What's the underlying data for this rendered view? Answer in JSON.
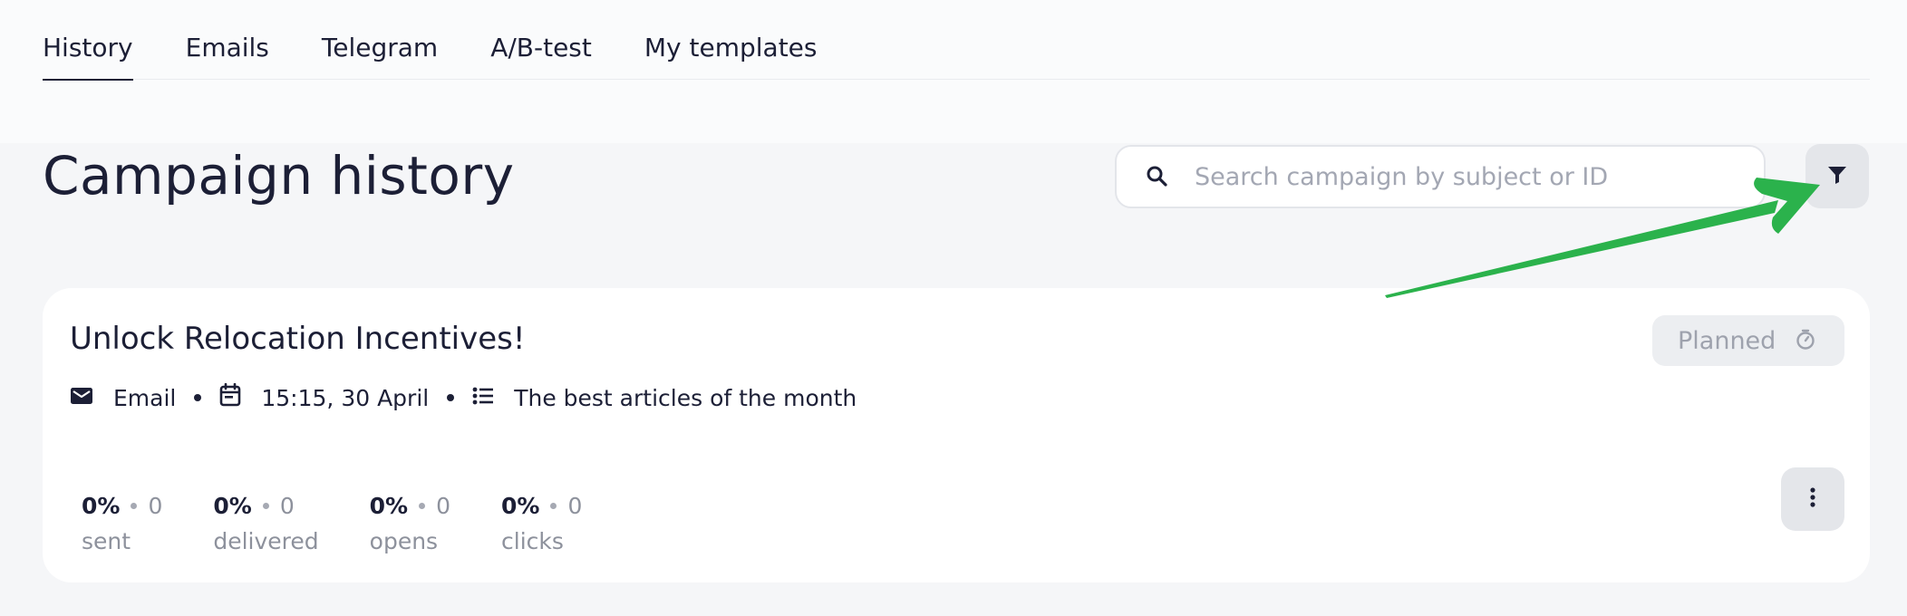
{
  "tabs": [
    {
      "label": "History",
      "active": true
    },
    {
      "label": "Emails"
    },
    {
      "label": "Telegram"
    },
    {
      "label": "A/B-test"
    },
    {
      "label": "My templates"
    }
  ],
  "page_title": "Campaign history",
  "search": {
    "placeholder": "Search campaign by subject or ID",
    "value": "",
    "icon": "search-icon"
  },
  "filter": {
    "icon": "filter-icon"
  },
  "campaign": {
    "title": "Unlock Relocation Incentives!",
    "status": "Planned",
    "status_icon": "timer-icon",
    "meta": {
      "channel": "Email",
      "channel_icon": "envelope-icon",
      "datetime": "15:15, 30 April",
      "datetime_icon": "calendar-icon",
      "list": "The best articles of the month",
      "list_icon": "list-icon"
    },
    "stats": [
      {
        "percent": "0%",
        "count": "0",
        "label": "sent"
      },
      {
        "percent": "0%",
        "count": "0",
        "label": "delivered"
      },
      {
        "percent": "0%",
        "count": "0",
        "label": "opens"
      },
      {
        "percent": "0%",
        "count": "0",
        "label": "clicks"
      }
    ],
    "more_icon": "more-vertical-icon"
  },
  "colors": {
    "accent_arrow": "#2bb24c",
    "text": "#1c1f36",
    "muted": "#8d919c",
    "background": "#f5f6f8"
  }
}
